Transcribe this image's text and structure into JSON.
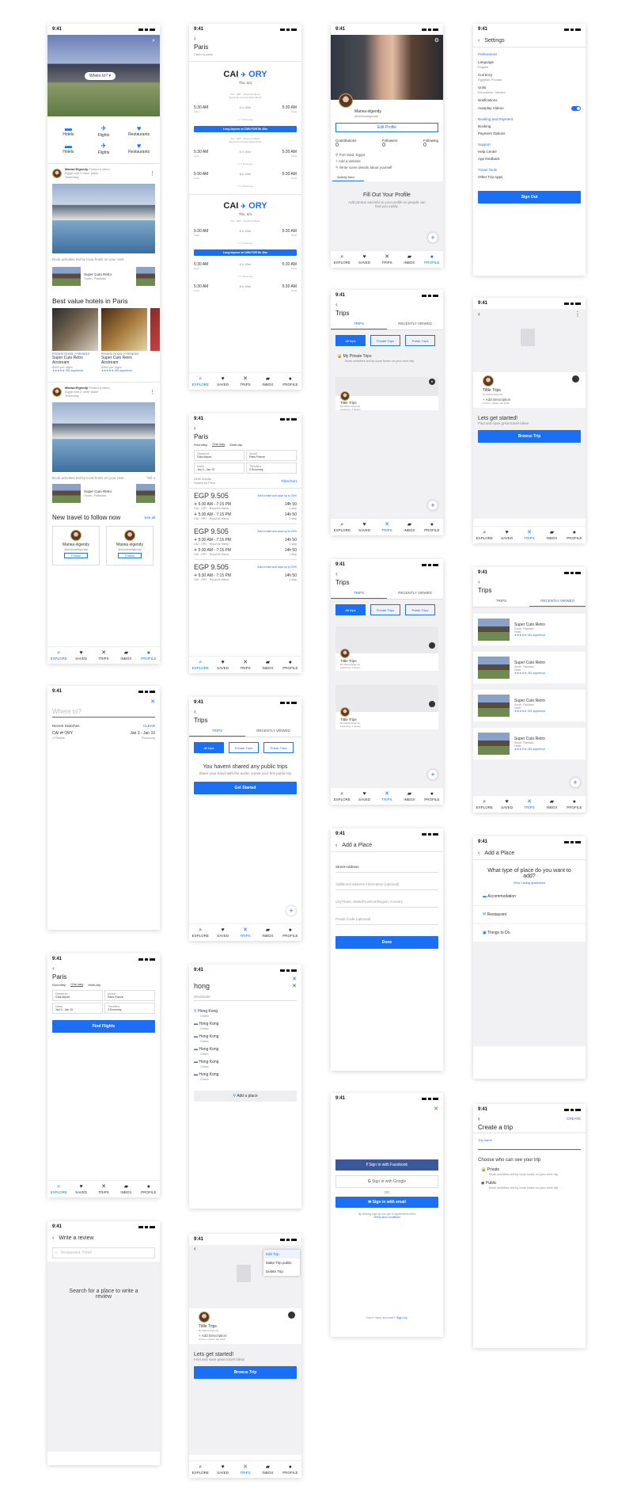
{
  "status": {
    "time": "9:41"
  },
  "nav": {
    "explore": "EXPLORE",
    "saved": "SAVED",
    "trips": "TRIPS",
    "inbox": "INBOX",
    "profile": "PROFILE"
  },
  "home": {
    "where": "Where to?",
    "cats": [
      "Hotels",
      "Flights",
      "Restaurants",
      "Hotels",
      "Flights",
      "Restaurants"
    ],
    "post_user": "Marwa Elgendy",
    "post_action": "Posted a video",
    "post_loc": "Egypt and 2 other place",
    "post_time": "Yesterday",
    "caption": "Book activities led by local hosts on your next",
    "hotel_name": "Super Cuto Retro",
    "hotel_loc": "South, Pakistan",
    "best_title": "Best value hotels in Paris",
    "card_tag": "PRIVATE ROOM, PYRENEES",
    "card_name": "Super Cuto Retro Airstream",
    "card_price": "$300 per night",
    "card_rating": "★★★★★ 451 superhost",
    "post2_user": "Marwa Elgendy",
    "post2_action": "Posted a video",
    "post2_loc": "Egypt and 2 other place",
    "post2_time": "Yesterday",
    "caption2": "Book activities led by local hosts on your next",
    "caption2_more": "Tell u",
    "follow_title": "New travel to follow now",
    "see_all": "See all",
    "f_name": "Marwa elgendy",
    "f_handle": "@marwaelgendy",
    "follow": "Follow"
  },
  "results": {
    "title": "Paris",
    "sub": "Cairo to paris",
    "from": "CAI",
    "to": "ORY",
    "date": "Thu, 6/1",
    "seg_dep": "5:30 AM",
    "seg_arr": "5:30 AM",
    "seg_dur": "6 h 40m",
    "seg_air": "CAI - ORY · Royal Air Maroc",
    "seg_air2": "Egypt Air operates flight #4444",
    "seg_depl": "Cairo",
    "seg_arrl": "Paris",
    "economy": "Economy",
    "layover": "Long layover at CMN FOR 8h 40m"
  },
  "list": {
    "title": "Paris",
    "tabs": [
      "Roundtrip",
      "One-way",
      "Multi-city"
    ],
    "depart_l": "Departure",
    "depart": "Giza Airport",
    "arrive_l": "Arrival",
    "arrive": "Paris France",
    "dates_l": "Dates",
    "dates": "Jan 3 - Jan 10",
    "travel_l": "Travellers",
    "travel": "2 Economy",
    "count": "2456 results",
    "sorted": "Sorted by Price",
    "filter": "Filter/Sort",
    "price": "EGP 9.505",
    "add": "Add a hotel and save up to 20%",
    "t": "5:30 AM - 7:15 PM",
    "dur": "14h 50",
    "stop": "1 stop",
    "air": "GAI - ORY · Royal Air Maroc"
  },
  "profile": {
    "name": "Marwa elgendy",
    "handle": "@marwaelgendy",
    "edit": "Edit Profile",
    "stats": [
      {
        "l": "Contributions",
        "v": "0"
      },
      {
        "l": "Followers",
        "v": "0"
      },
      {
        "l": "Following",
        "v": "0"
      }
    ],
    "loc": "Port Said, Egypt",
    "site": "Add a website",
    "about": "Write some details about yourself",
    "feed": "Activity feed",
    "fill_title": "Fill Out Your Profile",
    "fill_body": "Add photos and info to your profile so people can find you easily."
  },
  "settings": {
    "title": "Settings",
    "pref": "Preferences",
    "lang_l": "Language",
    "lang": "English",
    "cur_l": "Currency",
    "cur": "Egyptian Pounds",
    "units_l": "Units",
    "units": "Kilometres / Metres",
    "notif": "Notifications",
    "autoplay": "Autoplay Videos",
    "booking": "Booking and Payment",
    "book": "Booking",
    "pay": "Payment Options",
    "support": "Support",
    "help": "Help Center",
    "feedback": "App feedback",
    "tools": "Travel Tools",
    "other": "Other Trip Apps",
    "signout": "Sign Out"
  },
  "trips": {
    "title": "Trips",
    "tabs": [
      "TRIPS",
      "RECENTLY VIEWED"
    ],
    "pills": [
      "All trips",
      "Private Trips",
      "Public Trips"
    ],
    "private_title": "My Private Trips",
    "private_body": "Book activities led by local hosts on your next trip.",
    "trip_title": "Tittle Trips",
    "by": "By Marwa Elgendy",
    "featuring": "Featuring: 3 places",
    "no_public": "You havent shared any public trips",
    "no_public_body": "Share your travel with the world, create your first public trip",
    "get_started": "Get Started"
  },
  "tripd": {
    "title": "Tittle Trips",
    "by": "By Marwa Elgendy",
    "add_desc": "+ Add Description",
    "meta": "0 items, update Jan 2019",
    "lets": "Lets get started!",
    "lets_sub": "Find and save great travel ideas",
    "browse": "Browse Trip",
    "menu": [
      "Edit Trip",
      "Make Trip public",
      "Delete Trip"
    ]
  },
  "recent": {
    "items": [
      {
        "n": "Super Cuto Retro",
        "l": "South, Pakistan",
        "t": "Hotel",
        "r": "★★★★★ 451 superhost"
      },
      {
        "n": "Super Cuto Retro",
        "l": "South, Pakistan",
        "t": "Hotel",
        "r": "★★★★★ 451 superhost"
      },
      {
        "n": "Super Cuto Retro",
        "l": "South, Pakistan",
        "t": "Hotel",
        "r": "★★★★★ 451 superhost"
      },
      {
        "n": "Super Cuto Retro",
        "l": "South, Pakistan",
        "t": "Hotel",
        "r": "★★★★★ 451 superhost"
      }
    ]
  },
  "search": {
    "placeholder": "Where to?",
    "recent": "Recent Searches",
    "clear": "CLEAR",
    "route": "CAI",
    "route2": "ORY",
    "people": "1 People",
    "dates": "Jan 3 - Jan 10",
    "cls": "Economy"
  },
  "find": {
    "title": "Paris",
    "btn": "Find Flights"
  },
  "hong": {
    "query": "hong",
    "scope": "Worldwide",
    "items": [
      {
        "n": "Hong Kong",
        "c": "China"
      },
      {
        "n": "Hong Kong",
        "c": "China"
      },
      {
        "n": "Hong Kong",
        "c": "China"
      },
      {
        "n": "Hong Kong",
        "c": "China"
      },
      {
        "n": "Hong Kong",
        "c": "China"
      },
      {
        "n": "Hong Kong",
        "c": "China"
      }
    ],
    "add": "Add a place"
  },
  "addplace": {
    "title": "Add a Place",
    "street": "Street Address",
    "extra": "Additional address information (optional)",
    "city": "City/Town, State/Province/Region, Country",
    "postal": "Postal Code (optional)",
    "done": "Done",
    "q": "What type of place do you want to add?",
    "guide": "View Listing guidelines",
    "opts": [
      "Accommodation",
      "Restaurant",
      "Things to Do"
    ]
  },
  "signin": {
    "fb": "Sign in with Facebook",
    "google": "Sign in with Google",
    "or": "OR",
    "email": "Sign in with email",
    "terms": "By clicking sign up you are in agreement of the",
    "terms2": "Terms and Conditions",
    "noacc": "Don't have account?",
    "signup": "Sign Up"
  },
  "create": {
    "title": "Create a trip",
    "create": "CREATE",
    "name": "Trip name",
    "who": "Choose who can see your trip",
    "priv": "Private",
    "priv_b": "Book activities led by local hosts on your next trip",
    "pub": "Public",
    "pub_b": "Book activities led by local hosts on your next trip"
  },
  "review": {
    "title": "Write a review",
    "ph": "Restaurant, Hotel",
    "body": "Search for a place to write a review"
  }
}
